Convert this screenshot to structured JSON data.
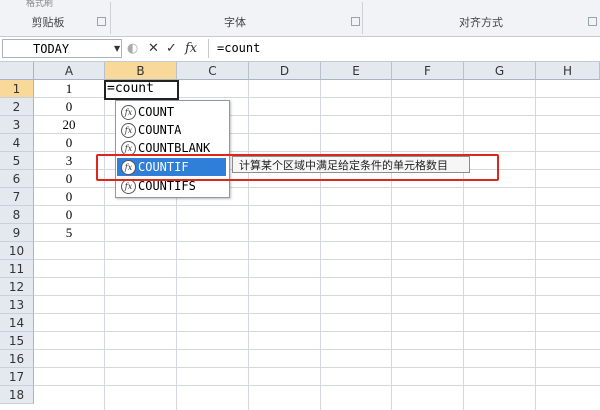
{
  "ribbon": {
    "clipboard_top_text": "格式刷",
    "groups": [
      "剪贴板",
      "字体",
      "对齐方式"
    ]
  },
  "formula_bar": {
    "name_box": "TODAY",
    "cancel_icon": "✕",
    "enter_icon": "✓",
    "fx_label": "fx",
    "formula": "=count"
  },
  "sheet": {
    "columns": [
      "A",
      "B",
      "C",
      "D",
      "E",
      "F",
      "G",
      "H"
    ],
    "selected_column": "B",
    "rows": [
      "1",
      "2",
      "3",
      "4",
      "5",
      "6",
      "7",
      "8",
      "9",
      "10",
      "11",
      "12",
      "13",
      "14",
      "15",
      "16",
      "17",
      "18"
    ],
    "selected_row": "1",
    "column_a_values": [
      "1",
      "0",
      "20",
      "0",
      "3",
      "0",
      "0",
      "0",
      "5"
    ],
    "active_cell_text": "=count"
  },
  "autocomplete": {
    "items": [
      "COUNT",
      "COUNTA",
      "COUNTBLANK",
      "COUNTIF",
      "COUNTIFS"
    ],
    "highlighted_index": 3,
    "tooltip": "计算某个区域中满足给定条件的单元格数目"
  },
  "colors": {
    "selection_blue": "#2f7ed8",
    "header_selected": "#f9d99a",
    "annotation_red": "#e0251b"
  }
}
